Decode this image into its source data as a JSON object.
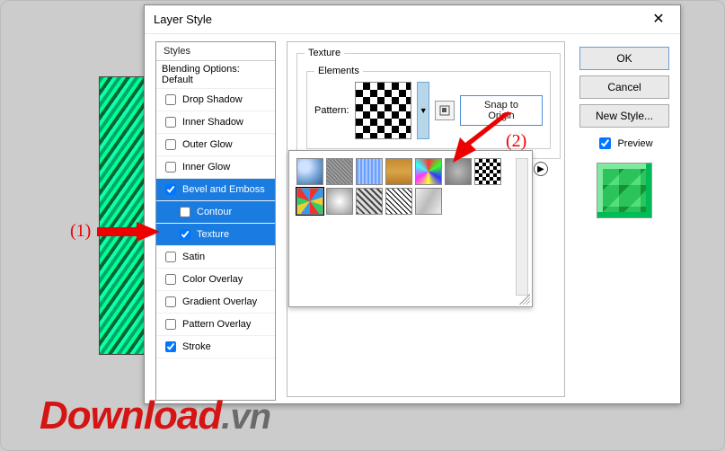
{
  "dialog": {
    "title": "Layer Style",
    "close": "✕"
  },
  "styles_panel": {
    "header": "Styles",
    "blending": "Blending Options: Default",
    "items": [
      {
        "label": "Drop Shadow",
        "checked": false,
        "selected": false,
        "indent": false
      },
      {
        "label": "Inner Shadow",
        "checked": false,
        "selected": false,
        "indent": false
      },
      {
        "label": "Outer Glow",
        "checked": false,
        "selected": false,
        "indent": false
      },
      {
        "label": "Inner Glow",
        "checked": false,
        "selected": false,
        "indent": false
      },
      {
        "label": "Bevel and Emboss",
        "checked": true,
        "selected": true,
        "indent": false
      },
      {
        "label": "Contour",
        "checked": false,
        "selected": true,
        "indent": true
      },
      {
        "label": "Texture",
        "checked": true,
        "selected": true,
        "indent": true
      },
      {
        "label": "Satin",
        "checked": false,
        "selected": false,
        "indent": false
      },
      {
        "label": "Color Overlay",
        "checked": false,
        "selected": false,
        "indent": false
      },
      {
        "label": "Gradient Overlay",
        "checked": false,
        "selected": false,
        "indent": false
      },
      {
        "label": "Pattern Overlay",
        "checked": false,
        "selected": false,
        "indent": false
      },
      {
        "label": "Stroke",
        "checked": true,
        "selected": false,
        "indent": false
      }
    ]
  },
  "texture": {
    "groupbox": "Texture",
    "elements_label": "Elements",
    "pattern_label": "Pattern:",
    "snap_label": "Snap to Origin"
  },
  "pattern_popup": {
    "selected_index": 7,
    "thumbs": [
      {
        "name": "Bubbles",
        "css": "radial-gradient(circle at 30% 30%, #cfe2ff 20%, #7aa6d8 55%, #32619a)"
      },
      {
        "name": "Gray noise",
        "css": "repeating-linear-gradient(45deg,#777 0 1px,#aaa 1px 2px,#888 2px 3px)"
      },
      {
        "name": "Blue stripe",
        "css": "repeating-linear-gradient(90deg,#6aa0ff 0 2px,#a9c7ff 2px 4px)"
      },
      {
        "name": "Wood",
        "css": "linear-gradient(#c78a2e,#d9a44a,#b97a22)"
      },
      {
        "name": "Tie dye",
        "css": "conic-gradient(#f33,#3f3,#33f,#ff3,#f3f,#3ff,#f33)"
      },
      {
        "name": "Rock",
        "css": "radial-gradient(circle,#bbb,#777)"
      },
      {
        "name": "Checker",
        "css": "repeating-conic-gradient(#000 0 25%,#fff 0 50%) 0 0/8px 8px"
      },
      {
        "name": "Confetti",
        "css": "repeating-conic-gradient(#e33 0 10%,#39e 0 20%,#ec3 0 30%,#3c6 0 40%)"
      },
      {
        "name": "Clouds",
        "css": "radial-gradient(#fff,#ccc,#999)"
      },
      {
        "name": "Maze",
        "css": "repeating-linear-gradient(45deg,#444 0 2px,#ddd 2px 5px)"
      },
      {
        "name": "Diag lines",
        "css": "repeating-linear-gradient(45deg,#000 0 1px,#fff 1px 4px)"
      },
      {
        "name": "Marble",
        "css": "linear-gradient(120deg,#eee,#bbb,#eee)"
      }
    ]
  },
  "right": {
    "ok": "OK",
    "cancel": "Cancel",
    "newstyle": "New Style...",
    "preview_label": "Preview",
    "preview_checked": true
  },
  "annotations": {
    "one": "(1)",
    "two": "(2)"
  },
  "watermark": {
    "a": "Download",
    "b": ".vn"
  }
}
